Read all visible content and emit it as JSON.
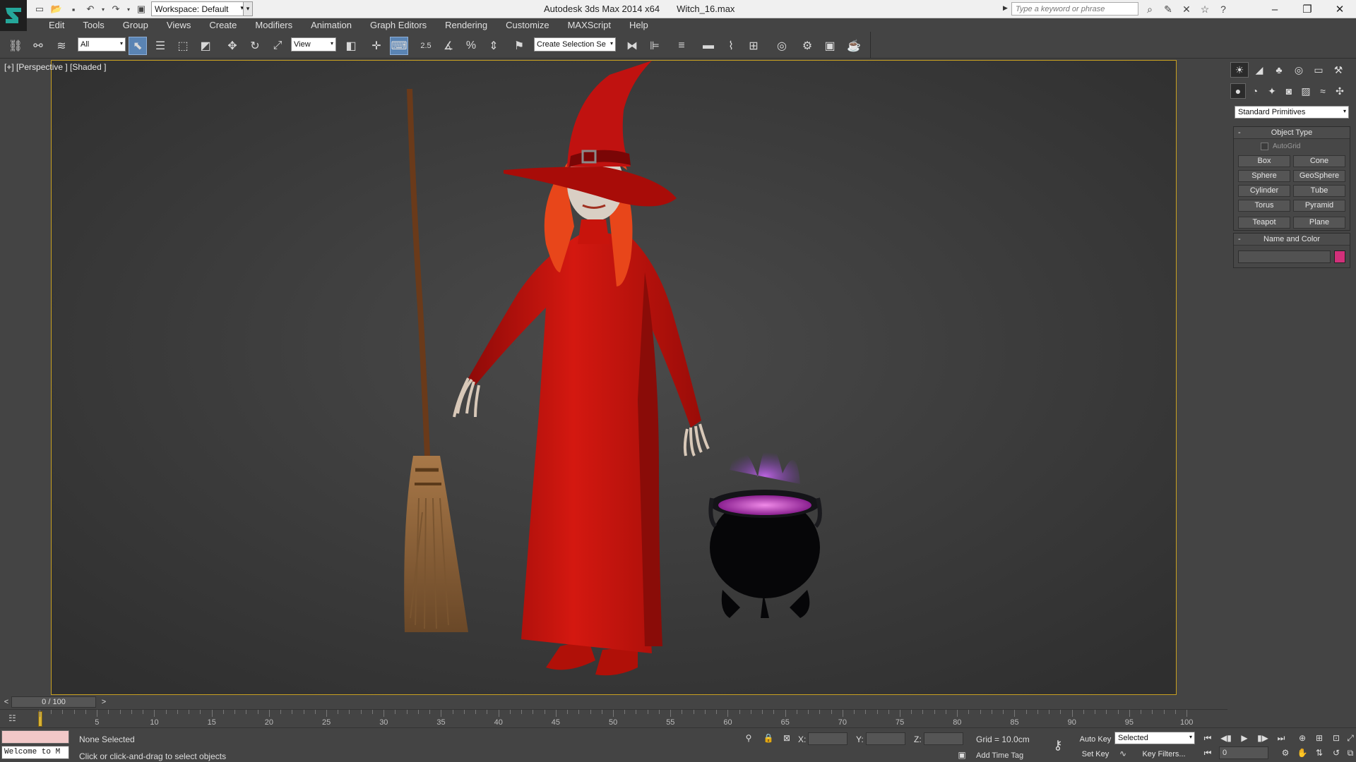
{
  "app": {
    "name": "Autodesk 3ds Max  2014 x64",
    "file": "Witch_16.max",
    "workspace": "Workspace: Default",
    "search_placeholder": "Type a keyword or phrase"
  },
  "menu": [
    "Edit",
    "Tools",
    "Group",
    "Views",
    "Create",
    "Modifiers",
    "Animation",
    "Graph Editors",
    "Rendering",
    "Customize",
    "MAXScript",
    "Help"
  ],
  "toolbar": {
    "selection_filter": "All",
    "reference_coord": "View",
    "snap_label": "2.5",
    "named_selection": "Create Selection Se"
  },
  "viewport": {
    "label": "[+] [Perspective ] [Shaded ]"
  },
  "command_panel": {
    "category": "Standard Primitives",
    "object_type_title": "Object Type",
    "autogrid": "AutoGrid",
    "buttons": [
      "Box",
      "Cone",
      "Sphere",
      "GeoSphere",
      "Cylinder",
      "Tube",
      "Torus",
      "Pyramid",
      "Teapot",
      "Plane"
    ],
    "name_color_title": "Name and Color",
    "minus": "-",
    "object_color": "#d2307a"
  },
  "timeline": {
    "frame_display": "0 / 100",
    "prev": "<",
    "next": ">",
    "ticks": [
      "5",
      "10",
      "15",
      "20",
      "25",
      "30",
      "35",
      "40",
      "45",
      "50",
      "55",
      "60",
      "65",
      "70",
      "75",
      "80",
      "85",
      "90",
      "95",
      "100"
    ]
  },
  "status": {
    "maxscript_listener": "Welcome to M",
    "selection": "None Selected",
    "prompt": "Click or click-and-drag to select objects",
    "x_label": "X:",
    "y_label": "Y:",
    "z_label": "Z:",
    "grid": "Grid = 10.0cm",
    "add_time_tag": "Add Time Tag",
    "auto_key": "Auto Key",
    "set_key": "Set Key",
    "key_mode": "Selected",
    "key_filters": "Key Filters...",
    "current_frame": "0"
  },
  "colors": {
    "accent": "#5a84b4",
    "viewport_border": "#c8a020",
    "dress": "#c0100c",
    "hair": "#e8461a",
    "potion": "#a040e0"
  }
}
